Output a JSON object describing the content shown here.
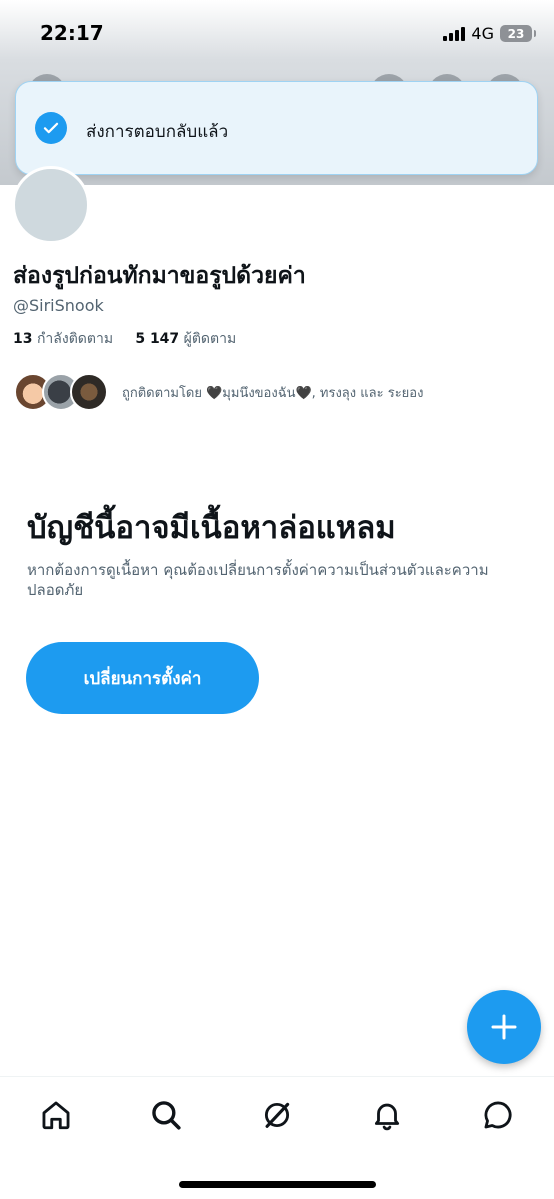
{
  "status_bar": {
    "time": "22:17",
    "network": "4G",
    "battery": "23"
  },
  "toast": {
    "icon": "check-circle-icon",
    "message": "ส่งการตอบกลับแล้ว"
  },
  "profile": {
    "display_name": "ส่องรูปก่อนทักมาขอรูปด้วยค่า",
    "handle": "@SiriSnook",
    "following_count": "13",
    "following_label": "กำลังติดตาม",
    "followers_count": "5 147",
    "followers_label": "ผู้ติดตาม",
    "followed_by_text": "ถูกติดตามโดย 🖤มุมนึงของฉัน🖤, ทรงลุง และ ระยอง"
  },
  "warning": {
    "title": "บัญชีนี้อาจมีเนื้อหาล่อแหลม",
    "description": "หากต้องการดูเนื้อหา คุณต้องเปลี่ยนการตั้งค่าความเป็นส่วนตัวและความปลอดภัย",
    "button_label": "เปลี่ยนการตั้งค่า"
  },
  "tabbar": {
    "items": [
      "home-icon",
      "search-icon",
      "grok-icon",
      "notifications-icon",
      "messages-icon"
    ]
  },
  "colors": {
    "accent": "#1d9bf0",
    "text_primary": "#0f1419",
    "text_secondary": "#536471"
  }
}
